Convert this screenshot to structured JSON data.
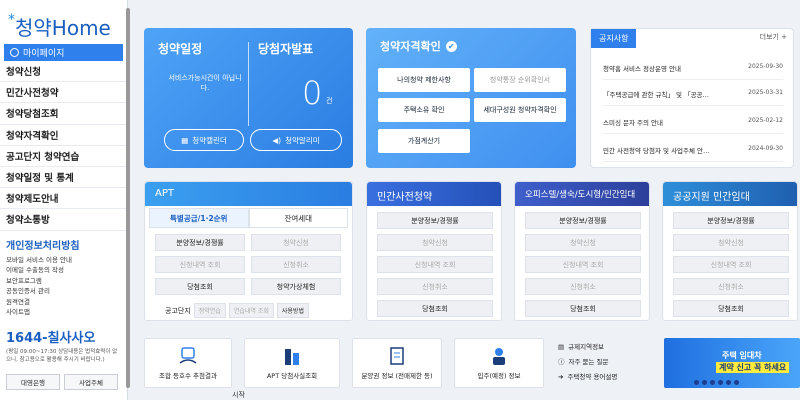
{
  "sidebar": {
    "logo": "청약Home",
    "mypage": "마이페이지",
    "menu": [
      "청약신청",
      "민간사전청약",
      "청약당첨조회",
      "청약자격확인",
      "공고단지 청약연습",
      "청약일정 및 통계",
      "청약제도안내",
      "청약소통방"
    ],
    "privacy": "개인정보처리방침",
    "links": [
      "모바일 서비스 이용 안내",
      "이메일 수출동의 작성",
      "보안프로그램",
      "공동인증서 관리",
      "원격연결",
      "사이트맵"
    ],
    "callcenter": "1644-칠사사오",
    "callnote": "(평일 09:00~17:30 상담내용은 법적효력이 없으니, 참고용으로 활용해 주시기 바랍니다.)",
    "bottom_left": "대영은행",
    "bottom_right": "사업주체",
    "footer": "시작"
  },
  "schedule": {
    "title": "청약일정",
    "desc": "서비스가능시간이 아닙니다.",
    "btn_calendar": "청약캘린더",
    "btn_alarm": "청약알리미"
  },
  "winner": {
    "title": "당첨자발표",
    "count": "0",
    "unit": "건"
  },
  "qualify": {
    "title": "청약자격확인",
    "buttons": [
      "나의청약 제한사항",
      "청약통장 순위확인서",
      "주택소유 확인",
      "세대구성원 청약자격확인",
      "가점계산기"
    ]
  },
  "notice": {
    "tab": "공지사항",
    "more": "더보기",
    "items": [
      {
        "title": "청약홈 서비스 정상운영 안내",
        "date": "2025-09-30"
      },
      {
        "title": "「주택공급에 관한 규칙」 및 「공공…",
        "date": "2025-03-31"
      },
      {
        "title": "스미싱 문자 주의 안내",
        "date": "2025-02-12"
      },
      {
        "title": "민간 사전청약 당첨자 및 사업주체 안…",
        "date": "2024-09-30"
      }
    ]
  },
  "apt": {
    "title": "APT",
    "tab_special": "특별공급/1·2순위",
    "tab_rest": "잔여세대",
    "buttons": [
      "분양정보/경쟁률",
      "청약신청",
      "신청내역 조회",
      "신청취소",
      "당첨조회",
      "청약가상체험"
    ],
    "foot_label": "공고단지",
    "foot_chips": [
      "청약연습",
      "연습내역 조회",
      "사용방법"
    ]
  },
  "private": {
    "title": "민간사전청약",
    "buttons": [
      "분양정보/경쟁률",
      "청약신청",
      "신청내역 조회",
      "신청취소",
      "당첨조회"
    ]
  },
  "officetel": {
    "title": "오피스텔/생숙/도시형/민간임대",
    "buttons": [
      "분양정보/경쟁률",
      "청약신청",
      "신청내역 조회",
      "신청취소",
      "당첨조회"
    ]
  },
  "public": {
    "title": "공공지원 민간임대",
    "buttons": [
      "분양정보/경쟁률",
      "청약신청",
      "신청내역 조회",
      "신청취소",
      "당첨조회"
    ]
  },
  "quick": {
    "items": [
      "조합 등호수 추첨결과",
      "APT 당첨사실조회",
      "분양권 정보 (전매제한 등)",
      "입주(예정) 정보"
    ],
    "list": [
      "규제지역정보",
      "자주 묻는 질문",
      "주택청약 용어설명"
    ]
  },
  "banner": {
    "line1": "주택 임대차",
    "line2": "계약 신고 꼭 하세요"
  }
}
